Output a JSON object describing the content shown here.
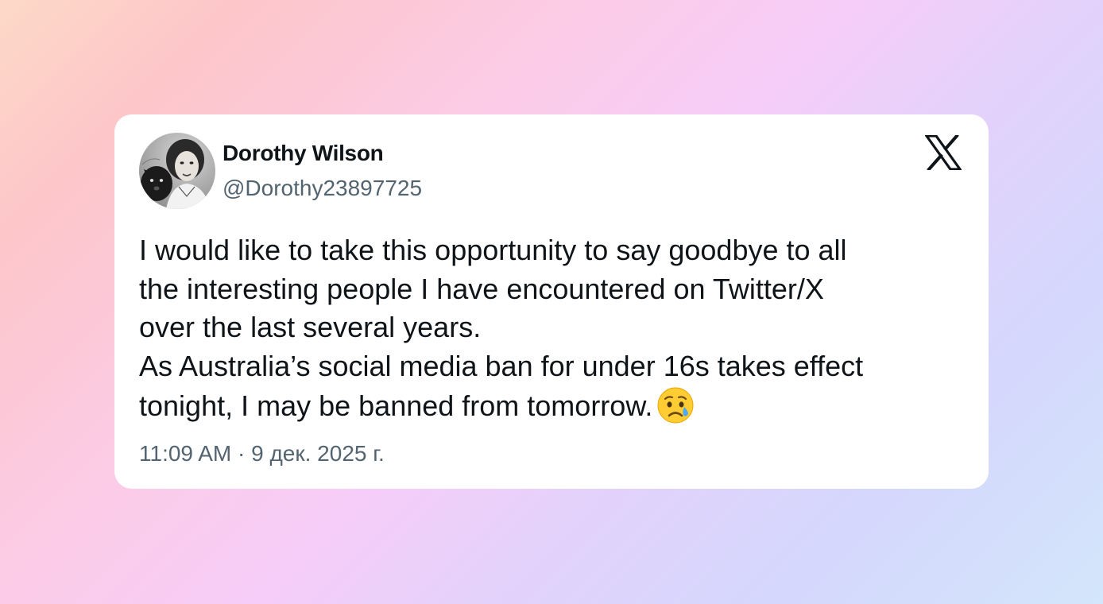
{
  "author": {
    "name": "Dorothy Wilson",
    "handle": "@Dorothy23897725",
    "avatar_icon": "profile-photo-avatar"
  },
  "platform_icon": "x-logo-icon",
  "tweet": {
    "lines": [
      "I would like to take this opportunity to say goodbye to all",
      "the interesting people I have encountered on Twitter/X",
      "over the last several years.",
      "As Australia’s social media ban for under 16s takes effect",
      "tonight, I may be banned from tomorrow."
    ],
    "emoji": "crying-face-emoji"
  },
  "meta": {
    "timestamp": "11:09 AM · 9 дек. 2025 г."
  },
  "colors": {
    "card_bg": "#ffffff",
    "text_primary": "#0f1419",
    "text_secondary": "#536471"
  }
}
